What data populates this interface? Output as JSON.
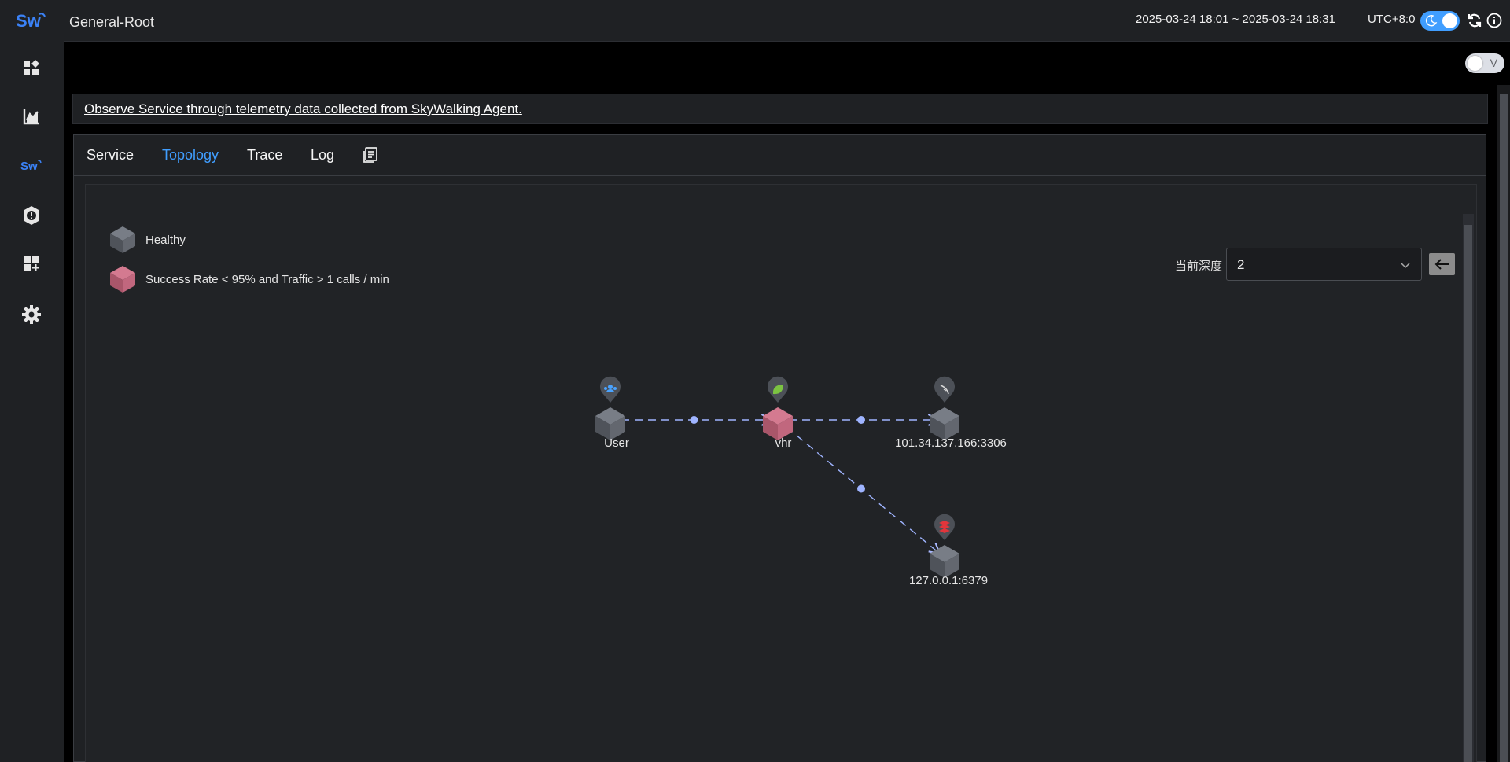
{
  "header": {
    "title": "General-Root",
    "time_range": "2025-03-24 18:01 ~ 2025-03-24 18:31",
    "timezone": "UTC+8:0"
  },
  "subbar": {
    "toggle_label": "V"
  },
  "banner": {
    "text": "Observe Service through telemetry data collected from SkyWalking Agent."
  },
  "tabs": [
    {
      "label": "Service",
      "active": false
    },
    {
      "label": "Topology",
      "active": true
    },
    {
      "label": "Trace",
      "active": false
    },
    {
      "label": "Log",
      "active": false
    }
  ],
  "legend": {
    "healthy": "Healthy",
    "unhealthy": "Success Rate < 95% and Traffic > 1 calls / min"
  },
  "depth": {
    "label": "当前深度",
    "value": "2"
  },
  "topology": {
    "nodes": [
      {
        "id": "user",
        "name": "User",
        "status": "healthy",
        "icon": "user-icon"
      },
      {
        "id": "vhr",
        "name": "vhr",
        "status": "unhealthy",
        "icon": "spring-leaf-icon"
      },
      {
        "id": "mysql",
        "name": "101.34.137.166:3306",
        "status": "healthy",
        "icon": "mysql-dolphin-icon"
      },
      {
        "id": "redis",
        "name": "127.0.0.1:6379",
        "status": "healthy",
        "icon": "redis-icon"
      }
    ],
    "edges": [
      {
        "from": "user",
        "to": "vhr"
      },
      {
        "from": "vhr",
        "to": "mysql"
      },
      {
        "from": "vhr",
        "to": "redis"
      }
    ]
  },
  "colors": {
    "accent": "#409eff",
    "healthy_node": "#5b6068",
    "unhealthy_node": "#c1677e",
    "edge": "#9fb4ff"
  }
}
